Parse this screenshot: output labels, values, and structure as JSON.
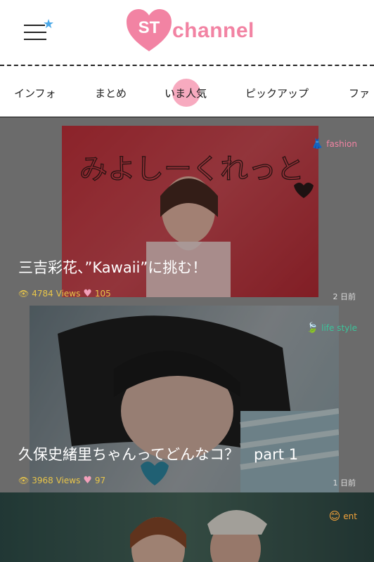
{
  "header": {
    "logo_text_1": "ST",
    "logo_text_2": "channel"
  },
  "tabs": [
    {
      "label": "インフォ"
    },
    {
      "label": "まとめ"
    },
    {
      "label": "いま人気"
    },
    {
      "label": "ピックアップ"
    },
    {
      "label": "ファ"
    }
  ],
  "feed": [
    {
      "category": "fashion",
      "title": "三吉彩花、”Kawaii”に挑む！",
      "views": "4784 Views",
      "likes": "105",
      "date": "2 日前",
      "photo_text": "みよしーくれっと"
    },
    {
      "category": "life style",
      "title": "久保史緒里ちゃんってどんなコ？　part 1",
      "views": "3968 Views",
      "likes": "97",
      "date": "1 日前"
    },
    {
      "category": "ent"
    }
  ],
  "colors": {
    "brand_pink": "#f283a3",
    "star_blue": "#4aa8e8",
    "fashion_pink": "#f283a3",
    "lifestyle_green": "#3cc39a",
    "ent_orange": "#f2a23a"
  }
}
